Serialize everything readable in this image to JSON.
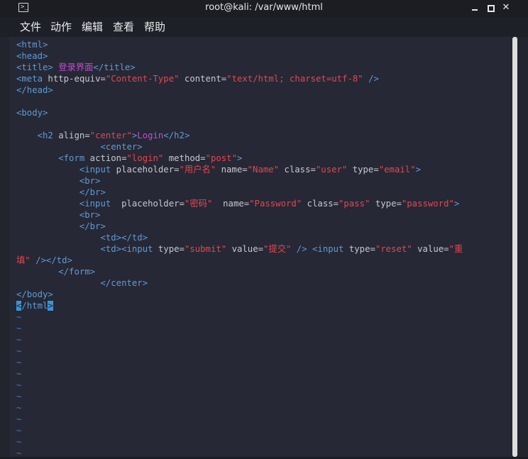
{
  "window": {
    "title": "root@kali: /var/www/html"
  },
  "menu": {
    "file": "文件",
    "action": "动作",
    "edit": "编辑",
    "view": "查看",
    "help": "帮助"
  },
  "code": {
    "l1_html": "<html>",
    "l2_head": "<head>",
    "l3_title_open": "<title>",
    "l3_title_text": " 登录界面",
    "l3_title_close": "</title>",
    "l4_meta": "<meta",
    "l4_attr1": " http-equiv=",
    "l4_val1": "\"Content-Type\"",
    "l4_attr2": " content=",
    "l4_val2": "\"text/html; charset=utf-8\"",
    "l4_end": " />",
    "l5_head_close": "</head>",
    "l7_body": "<body>",
    "l9_h2": "<h2",
    "l9_attr": " align=",
    "l9_val": "\"center\"",
    "l9_gt": ">",
    "l9_text": "Login",
    "l9_close": "</h2>",
    "l10_center": "<center>",
    "l11_form": "<form",
    "l11_attr1": " action=",
    "l11_val1": "\"login\"",
    "l11_attr2": " method=",
    "l11_val2": "\"post\"",
    "l11_gt": ">",
    "l12_input": "<input",
    "l12_attr1": " placeholder=",
    "l12_val1": "\"用户名\"",
    "l12_attr2": " name=",
    "l12_val2": "\"Name\"",
    "l12_attr3": " class=",
    "l12_val3": "\"user\"",
    "l12_attr4": " type=",
    "l12_val4": "\"email\"",
    "l12_gt": ">",
    "br": "<br>",
    "br_close": "</br>",
    "l15_input": "<input",
    "l15_attr1": "  placeholder=",
    "l15_val1": "\"密码\"",
    "l15_attr2": "  name=",
    "l15_val2": "\"Password\"",
    "l15_attr3": " class=",
    "l15_val3": "\"pass\"",
    "l15_attr4": " type=",
    "l15_val4": "\"password\"",
    "l15_gt": ">",
    "l18_td": "<td></td>",
    "l19_td": "<td>",
    "l19_input": "<input",
    "l19_attr1": " type=",
    "l19_val1": "\"submit\"",
    "l19_attr2": " value=",
    "l19_val2": "\"提交\"",
    "l19_end": " />",
    "l19_input2": " <input",
    "l19_attr3": " type=",
    "l19_val3": "\"reset\"",
    "l19_attr4": " value=",
    "l19_val4a": "\"重",
    "l20_val4b": "填\"",
    "l20_end": " />",
    "l20_td_close": "</td>",
    "l21_form_close": "</form>",
    "l22_center_close": "</center>",
    "l23_body_close": "</body>",
    "l24_cursor": "<",
    "l24_rest": "/html",
    "l24_gt": ">",
    "tilde": "~"
  }
}
